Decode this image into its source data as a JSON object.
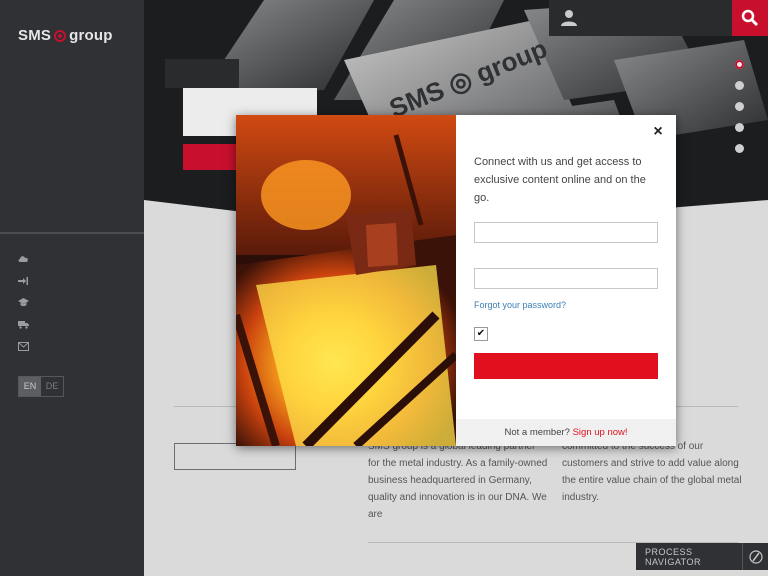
{
  "brand": {
    "logo_text_left": "SMS",
    "logo_text_right": "group",
    "accent": "#c8102e"
  },
  "sidebar": {
    "icons": [
      "cloud-icon",
      "sign-in-icon",
      "graduation-cap-icon",
      "truck-icon",
      "envelope-icon"
    ],
    "languages": [
      "EN",
      "DE"
    ],
    "active_language": "EN"
  },
  "hero": {
    "slides": 5,
    "active_slide": 1
  },
  "topbar": {
    "user_icon": "user-icon",
    "search_icon": "search-icon"
  },
  "content": {
    "para1": "SMS group is a global leading partner for the metal industry. As a family-owned business headquartered in Germany, quality and innovation is in our DNA. We are",
    "para2": "committed to the success of our customers and strive to add value along the entire value chain of the global metal industry."
  },
  "process_navigator": {
    "label": "PROCESS NAVIGATOR",
    "icon": "compass-icon"
  },
  "modal": {
    "close_label": "×",
    "intro": "Connect with us and get access to exclusive content online and on the go.",
    "username_placeholder": "",
    "password_placeholder": "",
    "forgot_label": "Forgot your password?",
    "remember_checked": true,
    "submit_label": "",
    "footer_text": "Not a member?",
    "signup_label": "Sign up now!"
  }
}
